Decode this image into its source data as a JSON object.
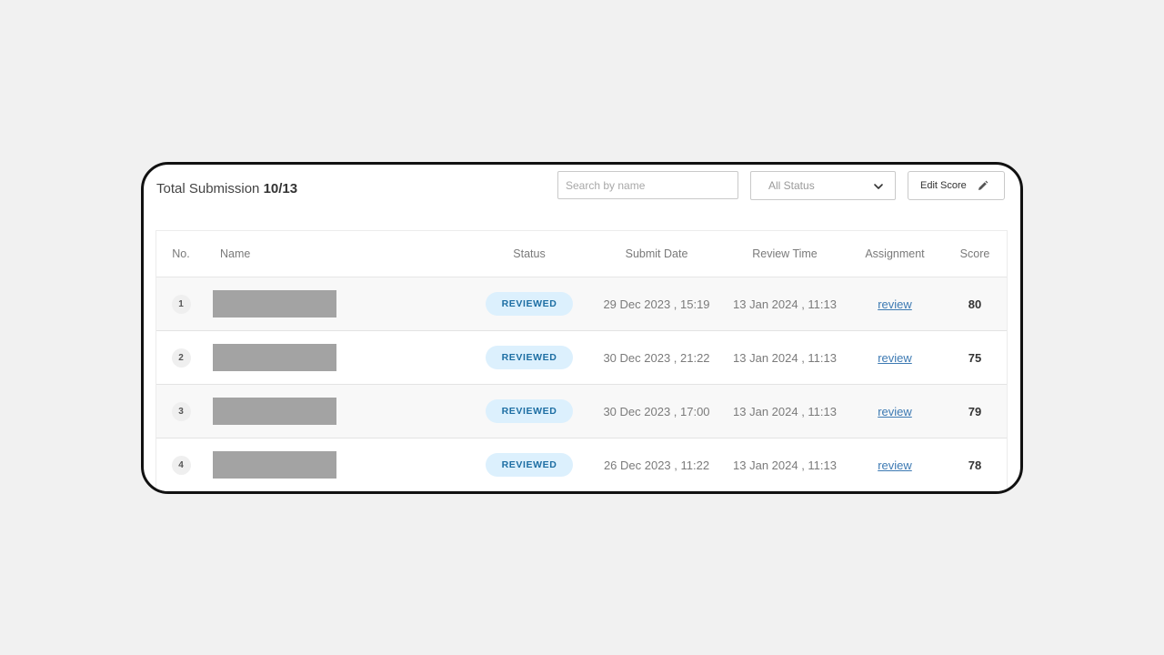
{
  "header": {
    "title_prefix": "Total Submission",
    "title_count": "10/13"
  },
  "controls": {
    "search_placeholder": "Search by name",
    "status_filter_value": "All Status",
    "edit_score_label": "Edit Score"
  },
  "table": {
    "columns": [
      "No.",
      "Name",
      "Status",
      "Submit Date",
      "Review Time",
      "Assignment",
      "Score"
    ],
    "rows": [
      {
        "no": "1",
        "status": "REVIEWED",
        "submit_date": "29 Dec 2023 , 15:19",
        "review_time": "13 Jan 2024 , 11:13",
        "assignment": "review",
        "score": "80"
      },
      {
        "no": "2",
        "status": "REVIEWED",
        "submit_date": "30 Dec 2023 , 21:22",
        "review_time": "13 Jan 2024 , 11:13",
        "assignment": "review",
        "score": "75"
      },
      {
        "no": "3",
        "status": "REVIEWED",
        "submit_date": "30 Dec 2023 , 17:00",
        "review_time": "13 Jan 2024 , 11:13",
        "assignment": "review",
        "score": "79"
      },
      {
        "no": "4",
        "status": "REVIEWED",
        "submit_date": "26 Dec 2023 , 11:22",
        "review_time": "13 Jan 2024 , 11:13",
        "assignment": "review",
        "score": "78"
      }
    ]
  },
  "icons": {
    "status_dropdown": "chevron-down-icon",
    "edit_score": "pencil-icon"
  },
  "colors": {
    "status_badge_bg": "#dcf0fd",
    "status_badge_text": "#1d6ea3",
    "link": "#3d7ab3",
    "redacted_name": "#a3a3a3"
  }
}
